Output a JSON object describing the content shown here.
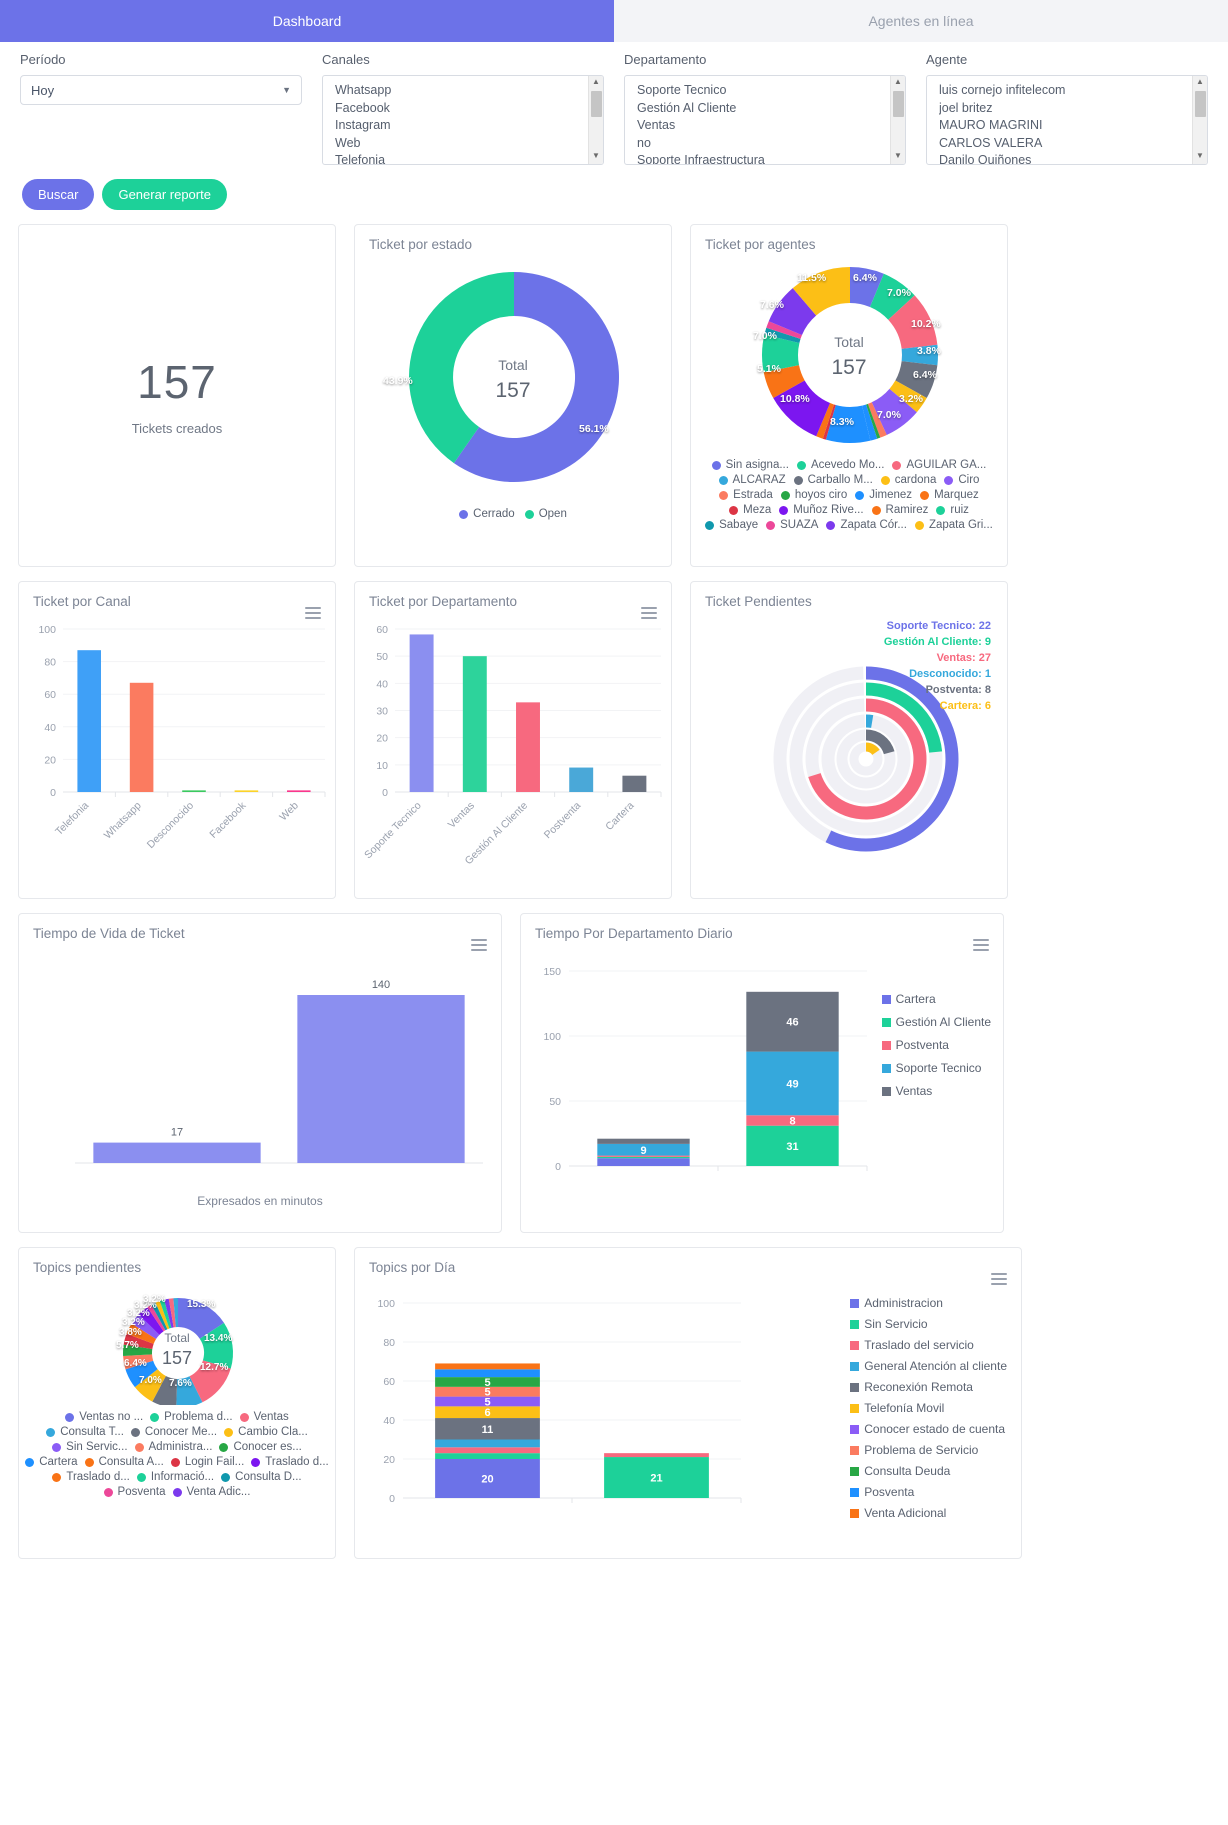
{
  "tabs": [
    {
      "label": "Dashboard",
      "active": true
    },
    {
      "label": "Agentes en línea",
      "active": false
    }
  ],
  "filters": {
    "periodo": {
      "label": "Período",
      "value": "Hoy",
      "chevron": "chevron-down-icon"
    },
    "canales": {
      "label": "Canales",
      "options": [
        "Whatsapp",
        "Facebook",
        "Instagram",
        "Web",
        "Telefonia"
      ]
    },
    "departamento": {
      "label": "Departamento",
      "options": [
        "Soporte Tecnico",
        "Gestión Al Cliente",
        "Ventas",
        "no",
        "Soporte Infraestructura"
      ]
    },
    "agente": {
      "label": "Agente",
      "options": [
        "luis cornejo infitelecom",
        "joel britez",
        "MAURO MAGRINI",
        "CARLOS VALERA",
        "Danilo Quiñones"
      ]
    }
  },
  "buttons": {
    "buscar": "Buscar",
    "generar": "Generar reporte"
  },
  "colors": {
    "primary": "#6c72e8",
    "success": "#1dd199",
    "danger": "#f7697f",
    "info": "#35a8dc",
    "gray": "#6b7280",
    "warning": "#fcbf16"
  },
  "cards": {
    "tickets_creados": {
      "value": "157",
      "label": "Tickets creados"
    },
    "ticket_estado": {
      "title": "Ticket por estado"
    },
    "ticket_agentes": {
      "title": "Ticket por agentes"
    },
    "ticket_canal": {
      "title": "Ticket por Canal"
    },
    "ticket_departamento": {
      "title": "Ticket por Departamento"
    },
    "ticket_pendientes": {
      "title": "Ticket Pendientes"
    },
    "tiempo_vida": {
      "title": "Tiempo de Vida de Ticket",
      "footer": "Expresados en minutos"
    },
    "tiempo_depto": {
      "title": "Tiempo Por Departamento Diario"
    },
    "topics_pendientes": {
      "title": "Topics pendientes"
    },
    "topics_dia": {
      "title": "Topics por Día"
    }
  },
  "chart_data": [
    {
      "id": "ticket_por_estado",
      "type": "pie",
      "title": "Ticket por estado",
      "center_label": "Total",
      "center_value": "157",
      "labels": [
        "Cerrado",
        "Open"
      ],
      "values": [
        88,
        69
      ],
      "percents": [
        "56.1%",
        "43.9%"
      ],
      "colors": [
        "#6c72e8",
        "#1dd199"
      ],
      "legend_position": "bottom"
    },
    {
      "id": "ticket_por_agentes",
      "type": "pie",
      "title": "Ticket por agentes",
      "center_label": "Total",
      "center_value": "157",
      "labels": [
        "Sin asigna...",
        "Acevedo Mo...",
        "AGUILAR GA...",
        "ALCARAZ",
        "Carballo M...",
        "cardona",
        "Ciro",
        "Estrada",
        "hoyos ciro",
        "Jimenez",
        "Marquez",
        "Meza",
        "Muñoz Rive...",
        "Ramirez",
        "ruiz",
        "Sabaye",
        "SUAZA",
        "Zapata Cór...",
        "Zapata Gri..."
      ],
      "percents": [
        "6.4%",
        "7.0%",
        "10.2%",
        "3.8%",
        "6.4%",
        "3.2%",
        "7.0%",
        "8.3%",
        "10.8%",
        "5.1%",
        "7.0%",
        "7.6%",
        "11.5%"
      ],
      "colors": [
        "#6c72e8",
        "#1dd199",
        "#f7697f",
        "#35a8dc",
        "#6b7280",
        "#fcbf16",
        "#8b5cf6",
        "#fb7b60",
        "#28a745",
        "#1e90ff",
        "#f97316",
        "#dc3545",
        "#7c16f0",
        "#f97316",
        "#1dd199",
        "#1098ad",
        "#ec4899",
        "#7c3aed",
        "#fcbf16"
      ],
      "legend_position": "bottom"
    },
    {
      "id": "ticket_por_canal",
      "type": "bar",
      "title": "Ticket por Canal",
      "categories": [
        "Telefonia",
        "Whatsapp",
        "Desconocido",
        "Facebook",
        "Web"
      ],
      "values": [
        87,
        67,
        1,
        1,
        1
      ],
      "colors": [
        "#3fa0f7",
        "#fb7b60",
        "#3bc95f",
        "#fcd32a",
        "#f9378c"
      ],
      "ylim": [
        0,
        100
      ],
      "yticks": [
        0,
        20,
        40,
        60,
        80,
        100
      ],
      "grid": true
    },
    {
      "id": "ticket_por_departamento",
      "type": "bar",
      "title": "Ticket por Departamento",
      "categories": [
        "Soporte Tecnico",
        "Ventas",
        "Gestión Al Cliente",
        "Postventa",
        "Cartera"
      ],
      "values": [
        58,
        50,
        33,
        9,
        6
      ],
      "colors": [
        "#8b8ff0",
        "#2dd39b",
        "#f7697f",
        "#4aa8d8",
        "#6b7280"
      ],
      "ylim": [
        0,
        60
      ],
      "yticks": [
        0,
        10,
        20,
        30,
        40,
        50,
        60
      ],
      "grid": true
    },
    {
      "id": "ticket_pendientes",
      "type": "bar",
      "title": "Ticket Pendientes",
      "orientation": "radial",
      "categories": [
        "Soporte Tecnico",
        "Gestión Al Cliente",
        "Ventas",
        "Desconocido",
        "Postventa",
        "Cartera"
      ],
      "values": [
        22,
        9,
        27,
        1,
        8,
        6
      ],
      "labels": [
        "Soporte Tecnico: 22",
        "Gestión Al Cliente: 9",
        "Ventas: 27",
        "Desconocido: 1",
        "Postventa: 8",
        "Cartera: 6"
      ],
      "colors": [
        "#6c72e8",
        "#1dd199",
        "#f7697f",
        "#35a8dc",
        "#6b7280",
        "#fcbf16"
      ]
    },
    {
      "id": "tiempo_de_vida_de_ticket",
      "type": "bar",
      "title": "Tiempo de Vida de Ticket",
      "categories": [
        "",
        ""
      ],
      "values": [
        17,
        140
      ],
      "data_labels": [
        "17",
        "140"
      ],
      "colors": [
        "#8b8ff0",
        "#8b8ff0"
      ],
      "xlabel": "Expresados en minutos",
      "ylim": [
        0,
        160
      ]
    },
    {
      "id": "tiempo_por_departamento_diario",
      "type": "bar",
      "stacked": true,
      "title": "Tiempo Por Departamento Diario",
      "categories": [
        "",
        ""
      ],
      "series": [
        {
          "name": "Cartera",
          "color": "#6c72e8",
          "values": [
            6,
            0
          ]
        },
        {
          "name": "Gestión Al Cliente",
          "color": "#1dd199",
          "values": [
            1,
            31
          ]
        },
        {
          "name": "Postventa",
          "color": "#f7697f",
          "values": [
            1,
            8
          ]
        },
        {
          "name": "Soporte Tecnico",
          "color": "#35a8dc",
          "values": [
            9,
            49
          ]
        },
        {
          "name": "Ventas",
          "color": "#6b7280",
          "values": [
            4,
            46
          ]
        }
      ],
      "visible_labels": [
        "6",
        "9",
        "4",
        "31",
        "8",
        "49",
        "46"
      ],
      "ylim": [
        0,
        150
      ],
      "yticks": [
        0,
        50,
        100,
        150
      ],
      "legend_position": "right"
    },
    {
      "id": "topics_pendientes",
      "type": "pie",
      "title": "Topics pendientes",
      "center_label": "Total",
      "center_value": "157",
      "percents": [
        "15.3%",
        "13.4%",
        "12.7%",
        "7.6%",
        "7.0%",
        "6.4%",
        "5.7%",
        "3.8%",
        "3.2%",
        "3.2%",
        "3.2%",
        "3.2%",
        "3.2%",
        "3.2%"
      ],
      "labels": [
        "Ventas no ...",
        "Problema d...",
        "Ventas",
        "Consulta T...",
        "Conocer Me...",
        "Cambio Cla...",
        "Sin Servic...",
        "Administra...",
        "Conocer es...",
        "Cartera",
        "Consulta A...",
        "Login Fail...",
        "Traslado d...",
        "Traslado d...",
        "Informació...",
        "Consulta D...",
        "Posventa",
        "Venta Adic..."
      ],
      "colors": [
        "#6c72e8",
        "#1dd199",
        "#f7697f",
        "#35a8dc",
        "#6b7280",
        "#fcbf16",
        "#8b5cf6",
        "#fb7b60",
        "#28a745",
        "#1e90ff",
        "#f97316",
        "#dc3545",
        "#7c16f0",
        "#f97316",
        "#1dd199",
        "#1098ad",
        "#ec4899",
        "#7c3aed"
      ]
    },
    {
      "id": "topics_por_dia",
      "type": "bar",
      "stacked": true,
      "title": "Topics por Día",
      "categories": [
        "",
        ""
      ],
      "series": [
        {
          "name": "Administracion",
          "color": "#6c72e8",
          "values": [
            20,
            0
          ]
        },
        {
          "name": "Sin Servicio",
          "color": "#1dd199",
          "values": [
            3,
            21
          ]
        },
        {
          "name": "Traslado del servicio",
          "color": "#f7697f",
          "values": [
            3,
            2
          ]
        },
        {
          "name": "General Atención al cliente",
          "color": "#35a8dc",
          "values": [
            4,
            0
          ]
        },
        {
          "name": "Reconexión Remota",
          "color": "#6b7280",
          "values": [
            11,
            0
          ]
        },
        {
          "name": "Telefonía Movil",
          "color": "#fcbf16",
          "values": [
            6,
            0
          ]
        },
        {
          "name": "Conocer estado de cuenta",
          "color": "#8b5cf6",
          "values": [
            5,
            0
          ]
        },
        {
          "name": "Problema de Servicio",
          "color": "#fb7b60",
          "values": [
            5,
            0
          ]
        },
        {
          "name": "Consulta Deuda",
          "color": "#28a745",
          "values": [
            5,
            0
          ]
        },
        {
          "name": "Posventa",
          "color": "#1e90ff",
          "values": [
            4,
            0
          ]
        },
        {
          "name": "Venta Adicional",
          "color": "#f97316",
          "values": [
            3,
            0
          ]
        }
      ],
      "visible_labels": [
        "20",
        "11",
        "6",
        "5",
        "5",
        "5",
        "4",
        "3",
        "3"
      ],
      "ylim": [
        0,
        100
      ],
      "yticks": [
        0,
        20,
        40,
        60,
        80,
        100
      ],
      "legend_position": "right"
    }
  ]
}
